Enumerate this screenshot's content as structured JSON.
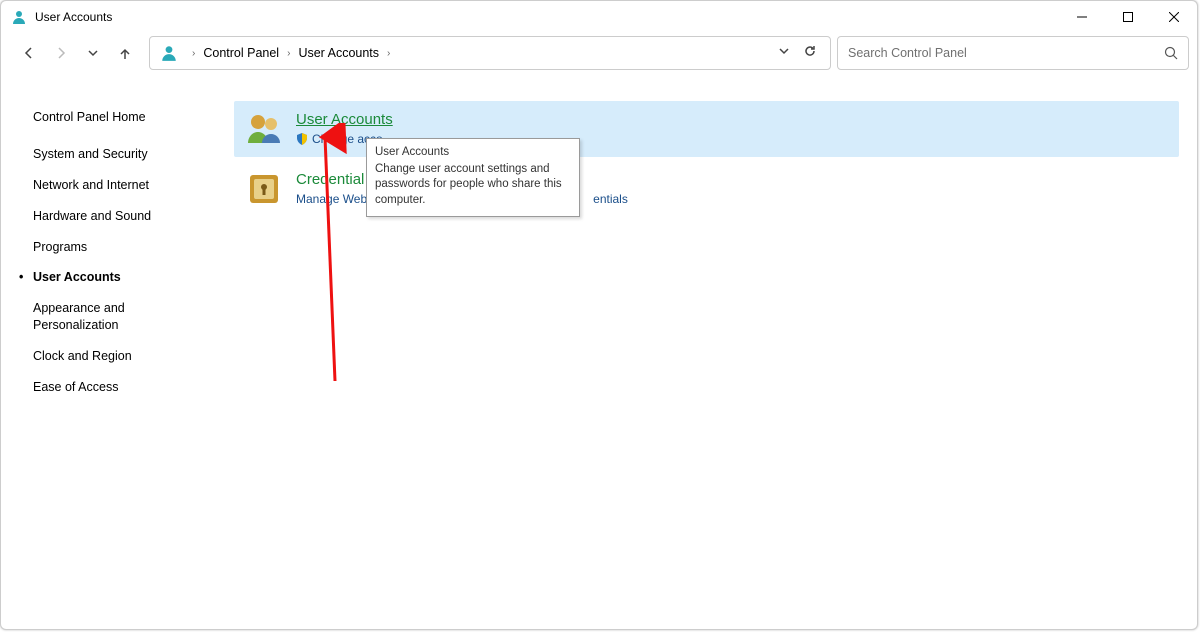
{
  "window": {
    "title": "User Accounts"
  },
  "breadcrumb": {
    "root": "Control Panel",
    "current": "User Accounts"
  },
  "search": {
    "placeholder": "Search Control Panel"
  },
  "sidebar": {
    "items": [
      {
        "label": "Control Panel Home",
        "active": false
      },
      {
        "label": "System and Security",
        "active": false
      },
      {
        "label": "Network and Internet",
        "active": false
      },
      {
        "label": "Hardware and Sound",
        "active": false
      },
      {
        "label": "Programs",
        "active": false
      },
      {
        "label": "User Accounts",
        "active": true
      },
      {
        "label": "Appearance and Personalization",
        "active": false
      },
      {
        "label": "Clock and Region",
        "active": false
      },
      {
        "label": "Ease of Access",
        "active": false
      }
    ]
  },
  "categories": [
    {
      "title": "User Accounts",
      "hover": true,
      "subs": [
        {
          "label": "Change account type",
          "shield": true
        }
      ],
      "partial_cutoff_label": "Change acco"
    },
    {
      "title": "Credential Manager",
      "title_visible_part": "Credential",
      "hover": false,
      "subs": [
        {
          "label": "Manage Web Credentials",
          "shield": false,
          "visible_left": "Manage Web C"
        },
        {
          "label": "Manage Windows Credentials",
          "shield": false,
          "visible_right": "entials"
        }
      ]
    }
  ],
  "tooltip": {
    "title": "User Accounts",
    "body": "Change user account settings and passwords for people who share this computer."
  }
}
